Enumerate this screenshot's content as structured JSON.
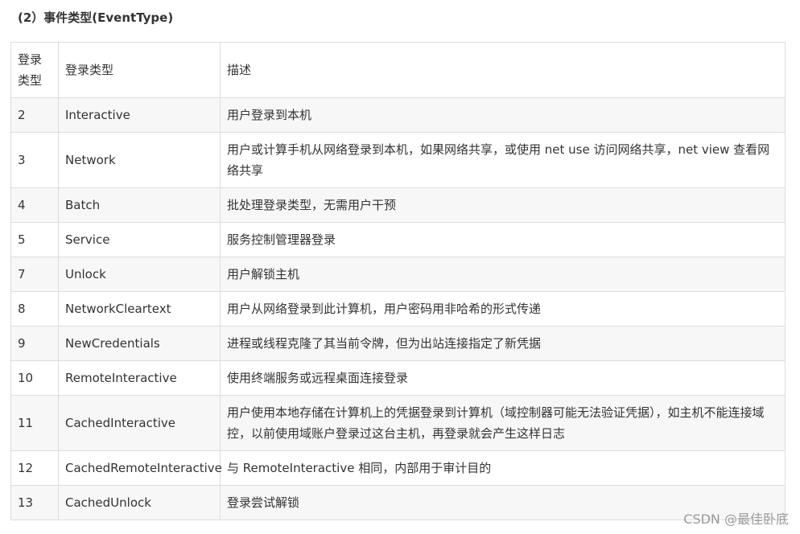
{
  "heading": "(2）事件类型(EventType)",
  "table": {
    "headers": [
      "登录类型",
      "登录类型",
      "描述"
    ],
    "rows": [
      {
        "id": "2",
        "type": "Interactive",
        "desc": "用户登录到本机"
      },
      {
        "id": "3",
        "type": "Network",
        "desc": "用户或计算手机从网络登录到本机，如果网络共享，或使用 net use 访问网络共享，net view 查看网络共享"
      },
      {
        "id": "4",
        "type": "Batch",
        "desc": "批处理登录类型，无需用户干预"
      },
      {
        "id": "5",
        "type": "Service",
        "desc": "服务控制管理器登录"
      },
      {
        "id": "7",
        "type": "Unlock",
        "desc": "用户解锁主机"
      },
      {
        "id": "8",
        "type": "NetworkCleartext",
        "desc": "用户从网络登录到此计算机，用户密码用非哈希的形式传递"
      },
      {
        "id": "9",
        "type": "NewCredentials",
        "desc": "进程或线程克隆了其当前令牌，但为出站连接指定了新凭据"
      },
      {
        "id": "10",
        "type": "RemoteInteractive",
        "desc": "使用终端服务或远程桌面连接登录"
      },
      {
        "id": "11",
        "type": "CachedInteractive",
        "desc": "用户使用本地存储在计算机上的凭据登录到计算机（域控制器可能无法验证凭据），如主机不能连接域控，以前使用域账户登录过这台主机，再登录就会产生这样日志"
      },
      {
        "id": "12",
        "type": "CachedRemoteInteractive",
        "desc": "与 RemoteInteractive 相同，内部用于审计目的"
      },
      {
        "id": "13",
        "type": "CachedUnlock",
        "desc": "登录尝试解锁"
      }
    ]
  },
  "watermark": "CSDN @最佳卧底"
}
